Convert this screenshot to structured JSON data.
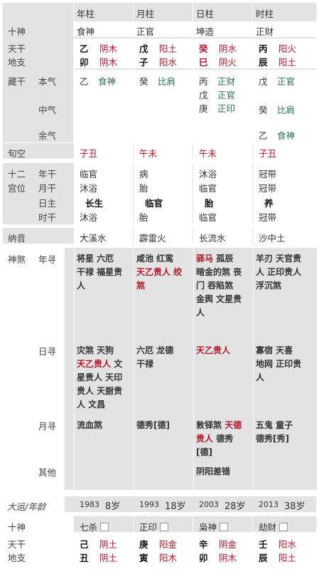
{
  "header": {
    "columns": [
      "年柱",
      "月柱",
      "日柱",
      "时柱"
    ]
  },
  "shishen": {
    "label": "十神",
    "values": [
      "食神",
      "正官",
      "坤造",
      "正财"
    ]
  },
  "tiangan": {
    "label": "天干",
    "values": [
      {
        "char": "乙",
        "wx": "阴木",
        "color": "dark"
      },
      {
        "char": "戊",
        "wx": "阳土",
        "color": "dark"
      },
      {
        "char": "癸",
        "wx": "阴水",
        "color": "red"
      },
      {
        "char": "丙",
        "wx": "阳火",
        "color": "dark"
      }
    ]
  },
  "dizhi": {
    "label": "地支",
    "values": [
      {
        "char": "卯",
        "wx": "阴木",
        "color": "dark"
      },
      {
        "char": "子",
        "wx": "阳水",
        "color": "dark"
      },
      {
        "char": "巳",
        "wx": "阴火",
        "color": "red"
      },
      {
        "char": "辰",
        "wx": "阳土",
        "color": "dark"
      }
    ]
  },
  "canggan": {
    "label": "藏干",
    "sub": [
      "本气",
      "中气",
      "余气"
    ],
    "cols": [
      [
        [
          "乙",
          "食神"
        ]
      ],
      [
        [
          "癸",
          "比肩"
        ]
      ],
      [
        [
          "丙",
          "正财"
        ],
        [
          "戊",
          "正官"
        ],
        [
          "庚",
          "正印"
        ]
      ],
      [
        [
          "戊",
          "正官"
        ],
        [
          "癸",
          "比肩"
        ],
        [
          "乙",
          "食神"
        ]
      ]
    ]
  },
  "xunkong": {
    "label": "旬空",
    "values": [
      "子丑",
      "午未",
      "午未",
      "子丑"
    ]
  },
  "changsheng": {
    "label1": "十二",
    "label2": "宫位",
    "sub": [
      "年干",
      "月干",
      "日主",
      "时干"
    ],
    "cols": [
      [
        "临官",
        "沐浴",
        "长生",
        "沐浴"
      ],
      [
        "病",
        "胎",
        "临官",
        "胎"
      ],
      [
        "沐浴",
        "临官",
        "胎",
        "临官"
      ],
      [
        "冠带",
        "冠带",
        "养",
        "冠带"
      ]
    ]
  },
  "nayin": {
    "label": "纳音",
    "values": [
      "大溪水",
      "霹雷火",
      "长流水",
      "沙中土"
    ]
  },
  "shensha": {
    "label": "神煞",
    "sub": [
      "年寻",
      "日寻",
      "月寻",
      "其他"
    ],
    "nianxun": [
      [
        [
          "将星 六厄",
          ""
        ],
        [
          "干禄 福星贵",
          ""
        ],
        [
          "人",
          ""
        ]
      ],
      [
        [
          "咸池 红鸾",
          ""
        ],
        [
          "天乙贵人 绞",
          "r"
        ],
        [
          "煞",
          "r"
        ]
      ],
      [
        [
          "驿马 孤辰",
          "rfirst"
        ],
        [
          "暗金的煞 丧",
          ""
        ],
        [
          "门 吞陷煞",
          ""
        ],
        [
          "金舆 文星贵",
          ""
        ],
        [
          "人",
          ""
        ]
      ],
      [
        [
          "羊刃 天官贵",
          ""
        ],
        [
          "人 正印贵人",
          ""
        ],
        [
          "浮沉煞",
          ""
        ]
      ]
    ],
    "rixun": [
      [
        [
          "灾煞 天狗",
          ""
        ],
        [
          "天乙贵人 文",
          "rpart"
        ],
        [
          "星贵人 天印",
          ""
        ],
        [
          "贵人 天厨贵",
          ""
        ],
        [
          "人 文昌",
          ""
        ]
      ],
      [
        [
          "六厄 龙德",
          ""
        ],
        [
          "干禄",
          ""
        ]
      ],
      [
        [
          "天乙贵人",
          "r"
        ]
      ],
      [
        [
          "寡宿 天喜",
          ""
        ],
        [
          "地网 正印贵",
          ""
        ],
        [
          "人",
          ""
        ]
      ]
    ],
    "yuexun": [
      [
        [
          "流血煞",
          ""
        ]
      ],
      [
        [
          "德秀[德]",
          ""
        ]
      ],
      [
        [
          "敦铎煞 天德",
          "rpart2"
        ],
        [
          "贵人 德秀",
          "rpart3"
        ],
        [
          "[德]",
          ""
        ]
      ],
      [
        [
          "五鬼 童子",
          ""
        ],
        [
          "德秀[秀]",
          ""
        ]
      ]
    ],
    "qita": [
      [],
      [],
      [
        [
          "阴阳差错",
          ""
        ]
      ],
      []
    ]
  },
  "dayun": {
    "label": "大运/年龄",
    "items": [
      {
        "year": "1983",
        "age": "8岁"
      },
      {
        "year": "1993",
        "age": "18岁"
      },
      {
        "year": "2003",
        "age": "28岁"
      },
      {
        "year": "2013",
        "age": "38岁"
      }
    ],
    "shishen": [
      "七杀",
      "正印",
      "枭神",
      "劫财"
    ],
    "tiangan": [
      {
        "char": "己",
        "wx": "阴土"
      },
      {
        "char": "庚",
        "wx": "阳金"
      },
      {
        "char": "辛",
        "wx": "阴金"
      },
      {
        "char": "壬",
        "wx": "阳水"
      }
    ],
    "dizhi": [
      {
        "char": "丑",
        "wx": "阴土"
      },
      {
        "char": "寅",
        "wx": "阳木"
      },
      {
        "char": "卯",
        "wx": "阴木"
      },
      {
        "char": "辰",
        "wx": "阳土"
      }
    ],
    "labels": {
      "shishen": "十神",
      "tiangan": "天干",
      "dizhi": "地支"
    }
  }
}
